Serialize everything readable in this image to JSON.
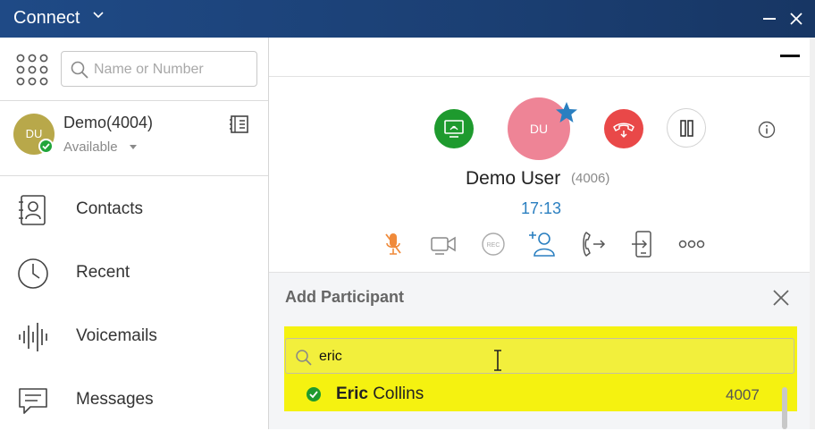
{
  "titlebar": {
    "title": "Connect",
    "icons": [
      "chevron-down-icon",
      "minimize-icon",
      "close-icon"
    ]
  },
  "search": {
    "placeholder": "Name or Number",
    "value": ""
  },
  "user": {
    "initials": "DU",
    "name": "Demo(4004)",
    "status": "Available"
  },
  "nav": {
    "items": [
      {
        "label": "Contacts",
        "icon": "contacts-icon"
      },
      {
        "label": "Recent",
        "icon": "clock-icon"
      },
      {
        "label": "Voicemails",
        "icon": "voicemail-icon"
      },
      {
        "label": "Messages",
        "icon": "message-icon"
      }
    ]
  },
  "call": {
    "caller_initials": "DU",
    "caller_name": "Demo User",
    "caller_ext": "(4006)",
    "duration": "17:13",
    "controls": [
      "screen-share-icon",
      "hangup-icon",
      "pause-icon",
      "info-icon"
    ],
    "tools": [
      "mute-icon",
      "video-icon",
      "record-icon",
      "add-participant-icon",
      "transfer-icon",
      "park-icon",
      "more-icon"
    ]
  },
  "add_participant": {
    "title": "Add Participant",
    "search_value": "eric",
    "results": [
      {
        "match": "Eric",
        "rest": " Collins",
        "ext": "4007"
      }
    ]
  },
  "colors": {
    "titlebar": "#1f4a86",
    "accent_blue": "#2a7fc0",
    "available_green": "#1e9a2e",
    "hangup_red": "#e94848",
    "caller_avatar": "#ee8496",
    "highlight_yellow": "#f5f210"
  }
}
